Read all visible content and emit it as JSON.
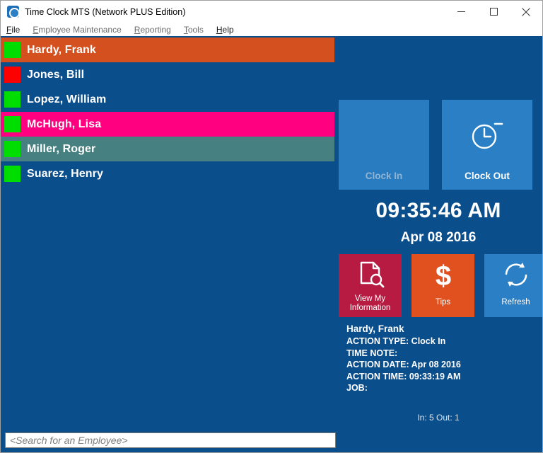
{
  "window": {
    "title": "Time Clock MTS (Network PLUS Edition)",
    "app_icon": "clock-app-icon",
    "background_color": "#0a4e8c",
    "controls": [
      {
        "name": "minimize",
        "glyph": "minimize-icon"
      },
      {
        "name": "maximize",
        "glyph": "maximize-icon"
      },
      {
        "name": "close",
        "glyph": "close-icon"
      }
    ]
  },
  "menubar": {
    "items": [
      {
        "label": "File",
        "accel": "F",
        "enabled": true
      },
      {
        "label": "Employee Maintenance",
        "accel": "E",
        "enabled": false
      },
      {
        "label": "Reporting",
        "accel": "R",
        "enabled": false
      },
      {
        "label": "Tools",
        "accel": "T",
        "enabled": false
      },
      {
        "label": "Help",
        "accel": "H",
        "enabled": true
      }
    ]
  },
  "employee_list": {
    "rows": [
      {
        "name": "Hardy, Frank",
        "swatch_color": "#00dd00",
        "row_color": "#d4501e",
        "selected": true
      },
      {
        "name": "Jones, Bill",
        "swatch_color": "#ff0000",
        "row_color": "transparent",
        "selected": false
      },
      {
        "name": "Lopez, William",
        "swatch_color": "#00dd00",
        "row_color": "transparent",
        "selected": false
      },
      {
        "name": "McHugh, Lisa",
        "swatch_color": "#00dd00",
        "row_color": "#ff0080",
        "selected": false
      },
      {
        "name": "Miller, Roger",
        "swatch_color": "#00dd00",
        "row_color": "#468080",
        "selected": false
      },
      {
        "name": "Suarez, Henry",
        "swatch_color": "#00dd00",
        "row_color": "transparent",
        "selected": false
      }
    ]
  },
  "search": {
    "value": "",
    "placeholder": "<Search for an Employee>"
  },
  "clock_panel": {
    "clock_in": {
      "label": "Clock In",
      "icon": "clock-in-icon",
      "enabled": false,
      "color": "#2a7cc0"
    },
    "clock_out": {
      "label": "Clock Out",
      "icon": "clock-out-icon",
      "enabled": true,
      "color": "#2b7fc4"
    },
    "time": "09:35:46 AM",
    "date": "Apr 08 2016"
  },
  "action_tiles": [
    {
      "label_line1": "View My",
      "label_line2": "Information",
      "icon": "document-search-icon",
      "color": "#b81b42",
      "name": "view-my-information"
    },
    {
      "label_line1": "Tips",
      "label_line2": "",
      "icon": "dollar-icon",
      "color": "#e0511f",
      "name": "tips"
    },
    {
      "label_line1": "Refresh",
      "label_line2": "",
      "icon": "refresh-icon",
      "color": "#2b7fc4",
      "name": "refresh"
    }
  ],
  "status": {
    "employee_name": "Hardy, Frank",
    "action_type": "ACTION TYPE: Clock In",
    "time_note": "TIME NOTE:",
    "action_date": "ACTION DATE: Apr 08 2016",
    "action_time": "ACTION TIME: 09:33:19 AM",
    "job": "JOB:"
  },
  "footer": {
    "in_out_summary": "In: 5 Out: 1"
  }
}
